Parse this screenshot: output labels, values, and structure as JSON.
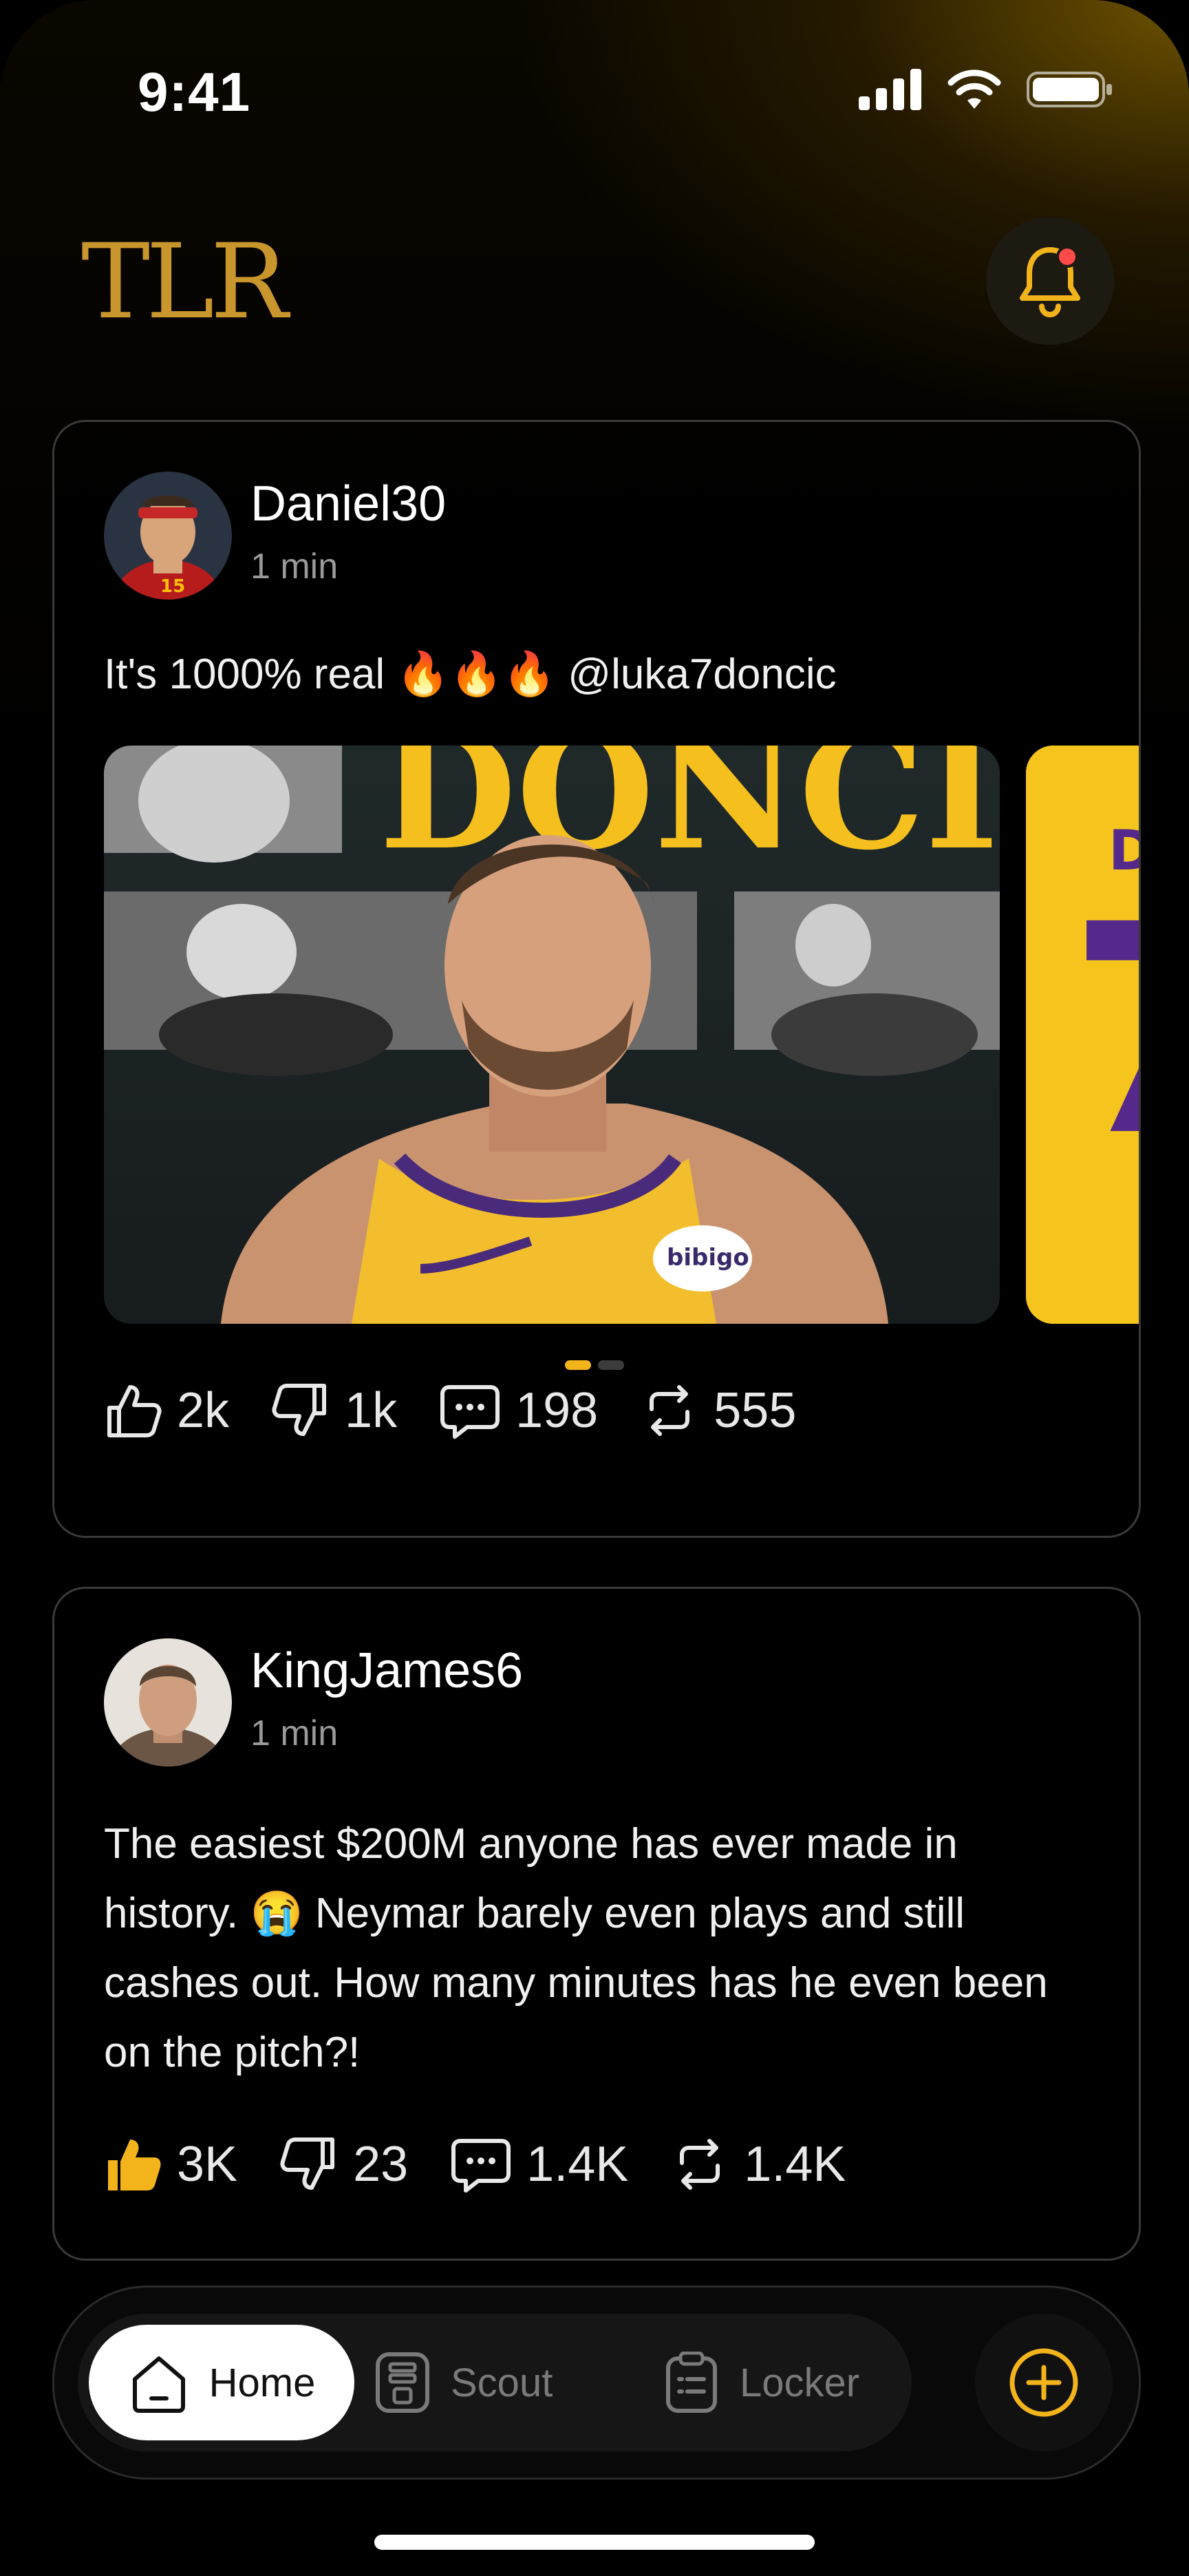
{
  "status": {
    "time": "9:41"
  },
  "header": {
    "logo": "TLR",
    "icons": {
      "notification": "bell-icon"
    }
  },
  "posts": [
    {
      "username": "Daniel30",
      "time": "1 min",
      "text": "It's 1000% real 🔥🔥🔥 @luka7doncic",
      "media_count": 2,
      "active_slide": 1,
      "stats": {
        "likes": "2k",
        "dislikes": "1k",
        "comments": "198",
        "reposts": "555"
      }
    },
    {
      "username": "KingJames6",
      "time": "1 min",
      "text": "The easiest $200M anyone has ever made in history. 😭 Neymar barely even plays and still cashes out. How many minutes has he even been on the pitch?!",
      "liked": true,
      "stats": {
        "likes": "3K",
        "dislikes": "23",
        "comments": "1.4K",
        "reposts": "1.4K"
      }
    }
  ],
  "nav": {
    "home": "Home",
    "scout": "Scout",
    "locker": "Locker",
    "active": "home"
  },
  "colors": {
    "accent": "#f3b41b",
    "gold_logo": "#c9962e",
    "notification_dot": "#ff4a4a"
  }
}
